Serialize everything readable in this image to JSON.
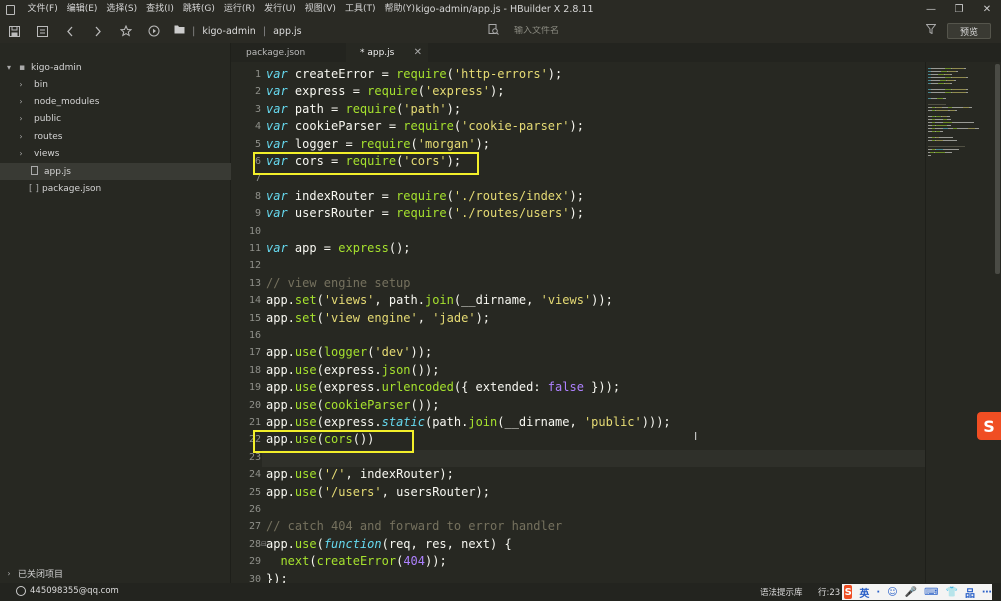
{
  "titlebar": {
    "menus": [
      "文件(F)",
      "编辑(E)",
      "选择(S)",
      "查找(I)",
      "跳转(G)",
      "运行(R)",
      "发行(U)",
      "视图(V)",
      "工具(T)",
      "帮助(Y)"
    ],
    "title": "kigo-admin/app.js - HBuilder X 2.8.11",
    "controls": {
      "minimize": "—",
      "restore": "❐",
      "close": "✕"
    }
  },
  "toolbar": {
    "breadcrumb": {
      "project": "kigo-admin",
      "file": "app.js"
    },
    "file_input_placeholder": "输入文件名",
    "preview_label": "预览"
  },
  "sidebar": {
    "project": "kigo-admin",
    "items": [
      {
        "label": "bin",
        "type": "folder"
      },
      {
        "label": "node_modules",
        "type": "folder"
      },
      {
        "label": "public",
        "type": "folder"
      },
      {
        "label": "routes",
        "type": "folder"
      },
      {
        "label": "views",
        "type": "folder"
      },
      {
        "label": "app.js",
        "type": "file",
        "selected": true
      },
      {
        "label": "package.json",
        "type": "json"
      }
    ],
    "closed_projects": "已关闭项目"
  },
  "tabs": [
    {
      "label": "package.json",
      "active": false
    },
    {
      "label": "* app.js",
      "active": true
    }
  ],
  "editor": {
    "line_numbers": [
      "1",
      "2",
      "3",
      "4",
      "5",
      "6",
      "7",
      "8",
      "9",
      "10",
      "11",
      "12",
      "13",
      "14",
      "15",
      "16",
      "17",
      "18",
      "19",
      "20",
      "21",
      "22",
      "23",
      "24",
      "25",
      "26",
      "27",
      "28",
      "29",
      "30"
    ],
    "lines": [
      [
        [
          "kw",
          "var"
        ],
        [
          "id",
          " createError = "
        ],
        [
          "fn",
          "require"
        ],
        [
          "id",
          "("
        ],
        [
          "str",
          "'http-errors'"
        ],
        [
          "id",
          ");"
        ]
      ],
      [
        [
          "kw",
          "var"
        ],
        [
          "id",
          " express = "
        ],
        [
          "fn",
          "require"
        ],
        [
          "id",
          "("
        ],
        [
          "str",
          "'express'"
        ],
        [
          "id",
          ");"
        ]
      ],
      [
        [
          "kw",
          "var"
        ],
        [
          "id",
          " path = "
        ],
        [
          "fn",
          "require"
        ],
        [
          "id",
          "("
        ],
        [
          "str",
          "'path'"
        ],
        [
          "id",
          ");"
        ]
      ],
      [
        [
          "kw",
          "var"
        ],
        [
          "id",
          " cookieParser = "
        ],
        [
          "fn",
          "require"
        ],
        [
          "id",
          "("
        ],
        [
          "str",
          "'cookie-parser'"
        ],
        [
          "id",
          ");"
        ]
      ],
      [
        [
          "kw",
          "var"
        ],
        [
          "id",
          " logger = "
        ],
        [
          "fn",
          "require"
        ],
        [
          "id",
          "("
        ],
        [
          "str",
          "'morgan'"
        ],
        [
          "id",
          ");"
        ]
      ],
      [
        [
          "kw",
          "var"
        ],
        [
          "id",
          " cors = "
        ],
        [
          "fn",
          "require"
        ],
        [
          "id",
          "("
        ],
        [
          "str",
          "'cors'"
        ],
        [
          "id",
          ");"
        ]
      ],
      [],
      [
        [
          "kw",
          "var"
        ],
        [
          "id",
          " indexRouter = "
        ],
        [
          "fn",
          "require"
        ],
        [
          "id",
          "("
        ],
        [
          "str",
          "'./routes/index'"
        ],
        [
          "id",
          ");"
        ]
      ],
      [
        [
          "kw",
          "var"
        ],
        [
          "id",
          " usersRouter = "
        ],
        [
          "fn",
          "require"
        ],
        [
          "id",
          "("
        ],
        [
          "str",
          "'./routes/users'"
        ],
        [
          "id",
          ");"
        ]
      ],
      [],
      [
        [
          "kw",
          "var"
        ],
        [
          "id",
          " app = "
        ],
        [
          "fn",
          "express"
        ],
        [
          "id",
          "();"
        ]
      ],
      [],
      [
        [
          "com",
          "// view engine setup"
        ]
      ],
      [
        [
          "id",
          "app."
        ],
        [
          "fn",
          "set"
        ],
        [
          "id",
          "("
        ],
        [
          "str",
          "'views'"
        ],
        [
          "id",
          ", path."
        ],
        [
          "fn",
          "join"
        ],
        [
          "id",
          "(__dirname, "
        ],
        [
          "str",
          "'views'"
        ],
        [
          "id",
          "));"
        ]
      ],
      [
        [
          "id",
          "app."
        ],
        [
          "fn",
          "set"
        ],
        [
          "id",
          "("
        ],
        [
          "str",
          "'view engine'"
        ],
        [
          "id",
          ", "
        ],
        [
          "str",
          "'jade'"
        ],
        [
          "id",
          ");"
        ]
      ],
      [],
      [
        [
          "id",
          "app."
        ],
        [
          "fn",
          "use"
        ],
        [
          "id",
          "("
        ],
        [
          "fn",
          "logger"
        ],
        [
          "id",
          "("
        ],
        [
          "str",
          "'dev'"
        ],
        [
          "id",
          "));"
        ]
      ],
      [
        [
          "id",
          "app."
        ],
        [
          "fn",
          "use"
        ],
        [
          "id",
          "(express."
        ],
        [
          "fn",
          "json"
        ],
        [
          "id",
          "());"
        ]
      ],
      [
        [
          "id",
          "app."
        ],
        [
          "fn",
          "use"
        ],
        [
          "id",
          "(express."
        ],
        [
          "fn",
          "urlencoded"
        ],
        [
          "id",
          "({ extended: "
        ],
        [
          "num",
          "false"
        ],
        [
          "id",
          " }));"
        ]
      ],
      [
        [
          "id",
          "app."
        ],
        [
          "fn",
          "use"
        ],
        [
          "id",
          "("
        ],
        [
          "fn",
          "cookieParser"
        ],
        [
          "id",
          "());"
        ]
      ],
      [
        [
          "id",
          "app."
        ],
        [
          "fn",
          "use"
        ],
        [
          "id",
          "(express."
        ],
        [
          "kw",
          "static"
        ],
        [
          "id",
          "(path."
        ],
        [
          "fn",
          "join"
        ],
        [
          "id",
          "(__dirname, "
        ],
        [
          "str",
          "'public'"
        ],
        [
          "id",
          ")));"
        ]
      ],
      [
        [
          "id",
          "app."
        ],
        [
          "fn",
          "use"
        ],
        [
          "id",
          "("
        ],
        [
          "fn",
          "cors"
        ],
        [
          "id",
          "())"
        ]
      ],
      [],
      [
        [
          "id",
          "app."
        ],
        [
          "fn",
          "use"
        ],
        [
          "id",
          "("
        ],
        [
          "str",
          "'/'"
        ],
        [
          "id",
          ", indexRouter);"
        ]
      ],
      [
        [
          "id",
          "app."
        ],
        [
          "fn",
          "use"
        ],
        [
          "id",
          "("
        ],
        [
          "str",
          "'/users'"
        ],
        [
          "id",
          ", usersRouter);"
        ]
      ],
      [],
      [
        [
          "com",
          "// catch 404 and forward to error handler"
        ]
      ],
      [
        [
          "id",
          "app."
        ],
        [
          "fn",
          "use"
        ],
        [
          "id",
          "("
        ],
        [
          "kw",
          "function"
        ],
        [
          "id",
          "(req, res, next) {"
        ]
      ],
      [
        [
          "id",
          "  "
        ],
        [
          "fn",
          "next"
        ],
        [
          "id",
          "("
        ],
        [
          "fn",
          "createError"
        ],
        [
          "id",
          "("
        ],
        [
          "num",
          "404"
        ],
        [
          "id",
          "));"
        ]
      ],
      [
        [
          "id",
          "});"
        ]
      ]
    ]
  },
  "statusbar": {
    "user": "445098355@qq.com",
    "tip": "语法提示库",
    "line": "行:23",
    "ime_logo": "S",
    "ime_items": [
      "英",
      "·",
      "☺",
      "🎤",
      "⌨",
      "👕",
      "品",
      "⋯"
    ]
  },
  "ime_float": "S",
  "colors": {
    "highlight": "#f2ef2a",
    "bg": "#272822"
  }
}
